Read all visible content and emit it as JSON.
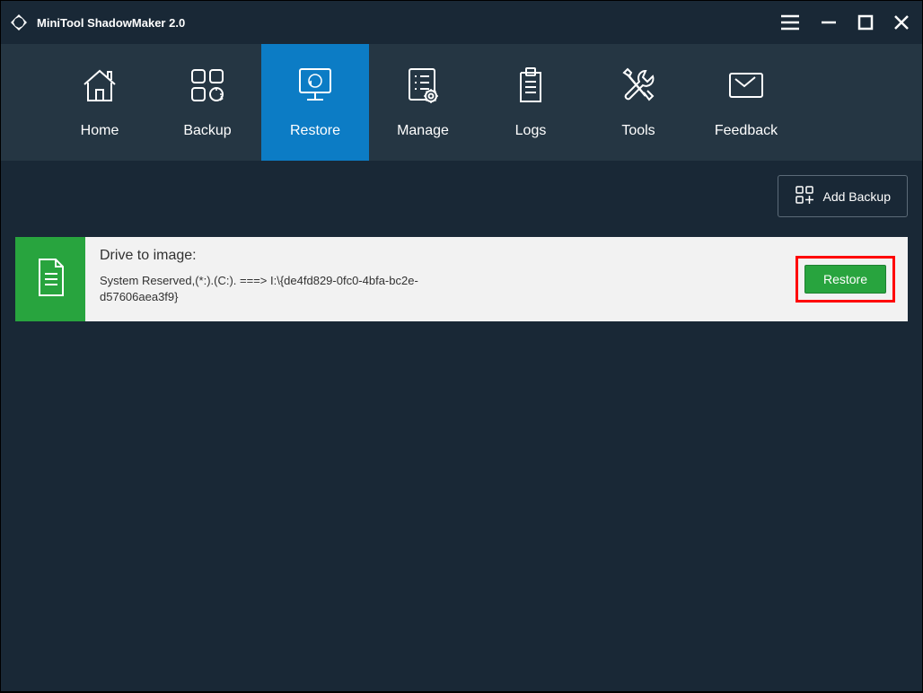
{
  "app": {
    "title": "MiniTool ShadowMaker 2.0"
  },
  "nav": {
    "items": [
      {
        "label": "Home"
      },
      {
        "label": "Backup"
      },
      {
        "label": "Restore"
      },
      {
        "label": "Manage"
      },
      {
        "label": "Logs"
      },
      {
        "label": "Tools"
      },
      {
        "label": "Feedback"
      }
    ]
  },
  "toolbar": {
    "add_backup_label": "Add Backup"
  },
  "backup_item": {
    "title": "Drive to image:",
    "details": " System Reserved,(*:).(C:). ===> I:\\{de4fd829-0fc0-4bfa-bc2e-d57606aea3f9}",
    "restore_label": "Restore"
  }
}
